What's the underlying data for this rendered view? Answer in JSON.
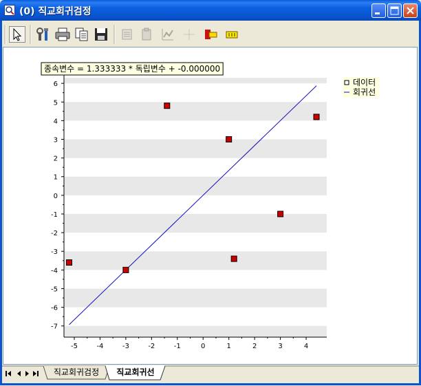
{
  "window": {
    "title": "(0) 직교회귀검정",
    "controls": [
      "minimize-icon",
      "maximize-icon",
      "close-icon"
    ]
  },
  "toolbar": {
    "items": [
      {
        "name": "select-pointer-button",
        "icon": "pointer-icon",
        "enabled": true,
        "pressed": true
      },
      {
        "name": "properties-button",
        "icon": "tools-icon",
        "enabled": true
      },
      {
        "name": "print-button",
        "icon": "printer-icon",
        "enabled": true
      },
      {
        "name": "copy-button",
        "icon": "copy-icon",
        "enabled": true
      },
      {
        "name": "save-button",
        "icon": "floppy-icon",
        "enabled": true
      },
      {
        "name": "data-edit-button",
        "icon": "data-icon",
        "enabled": false
      },
      {
        "name": "paste-button",
        "icon": "paste-icon",
        "enabled": false
      },
      {
        "name": "chart-format-button",
        "icon": "chart-format-icon",
        "enabled": false
      },
      {
        "name": "crosshair-button",
        "icon": "crosshair-icon",
        "enabled": false
      },
      {
        "name": "legend-button",
        "icon": "legend-icon",
        "enabled": true
      },
      {
        "name": "label-button",
        "icon": "label-icon",
        "enabled": true
      }
    ]
  },
  "chart_data": {
    "type": "scatter",
    "annotation": "종속변수 = 1.333333 * 독립변수 + -0.000000",
    "x_ticks": [
      -5,
      -4,
      -3,
      -2,
      -1,
      0,
      1,
      2,
      3,
      4
    ],
    "y_ticks": [
      6,
      5,
      4,
      3,
      2,
      1,
      0,
      -1,
      -2,
      -3,
      -4,
      -5,
      -6,
      -7
    ],
    "xlim": [
      -5.4,
      4.8
    ],
    "ylim": [
      -7.6,
      6.3
    ],
    "grid": "horizontal alternating bands",
    "legend_position": "top-right",
    "series": [
      {
        "name": "데이터",
        "kind": "points",
        "color": "#cc0000",
        "points": [
          {
            "x": -5.2,
            "y": -3.6
          },
          {
            "x": -3.0,
            "y": -4.0
          },
          {
            "x": -1.4,
            "y": 4.8
          },
          {
            "x": 1.0,
            "y": 3.0
          },
          {
            "x": 1.2,
            "y": -3.4
          },
          {
            "x": 3.0,
            "y": -1.0
          },
          {
            "x": 4.4,
            "y": 4.2
          }
        ]
      },
      {
        "name": "회귀선",
        "kind": "line",
        "color": "#1010c0",
        "points": [
          {
            "x": -5.2,
            "y": -6.93
          },
          {
            "x": 4.4,
            "y": 5.87
          }
        ]
      }
    ]
  },
  "tabs": {
    "nav_icons": [
      "first-icon",
      "prev-icon",
      "next-icon",
      "last-icon"
    ],
    "items": [
      {
        "label": "직교회귀검정",
        "active": false
      },
      {
        "label": "직교회귀선",
        "active": true
      }
    ]
  }
}
